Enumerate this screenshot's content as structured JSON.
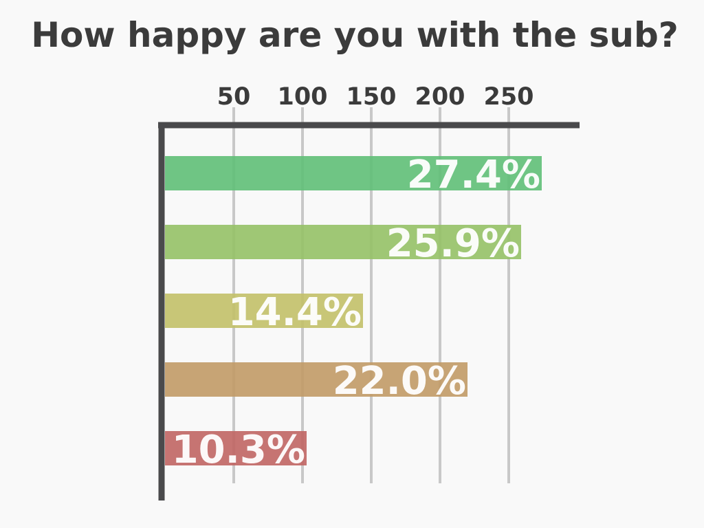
{
  "chart_data": {
    "type": "bar",
    "orientation": "horizontal",
    "title": "How happy are you with the sub?",
    "xlabel": "",
    "ylabel": "",
    "x_ticks": [
      50,
      100,
      150,
      200,
      250
    ],
    "xlim": [
      0,
      300
    ],
    "grid": true,
    "bars": [
      {
        "value": 274,
        "label": "27.4%",
        "color": "#5fbf77"
      },
      {
        "value": 259,
        "label": "25.9%",
        "color": "#95c166"
      },
      {
        "value": 144,
        "label": "14.4%",
        "color": "#c2c068"
      },
      {
        "value": 220,
        "label": "22.0%",
        "color": "#c19a66"
      },
      {
        "value": 103,
        "label": "10.3%",
        "color": "#c06563"
      }
    ]
  }
}
